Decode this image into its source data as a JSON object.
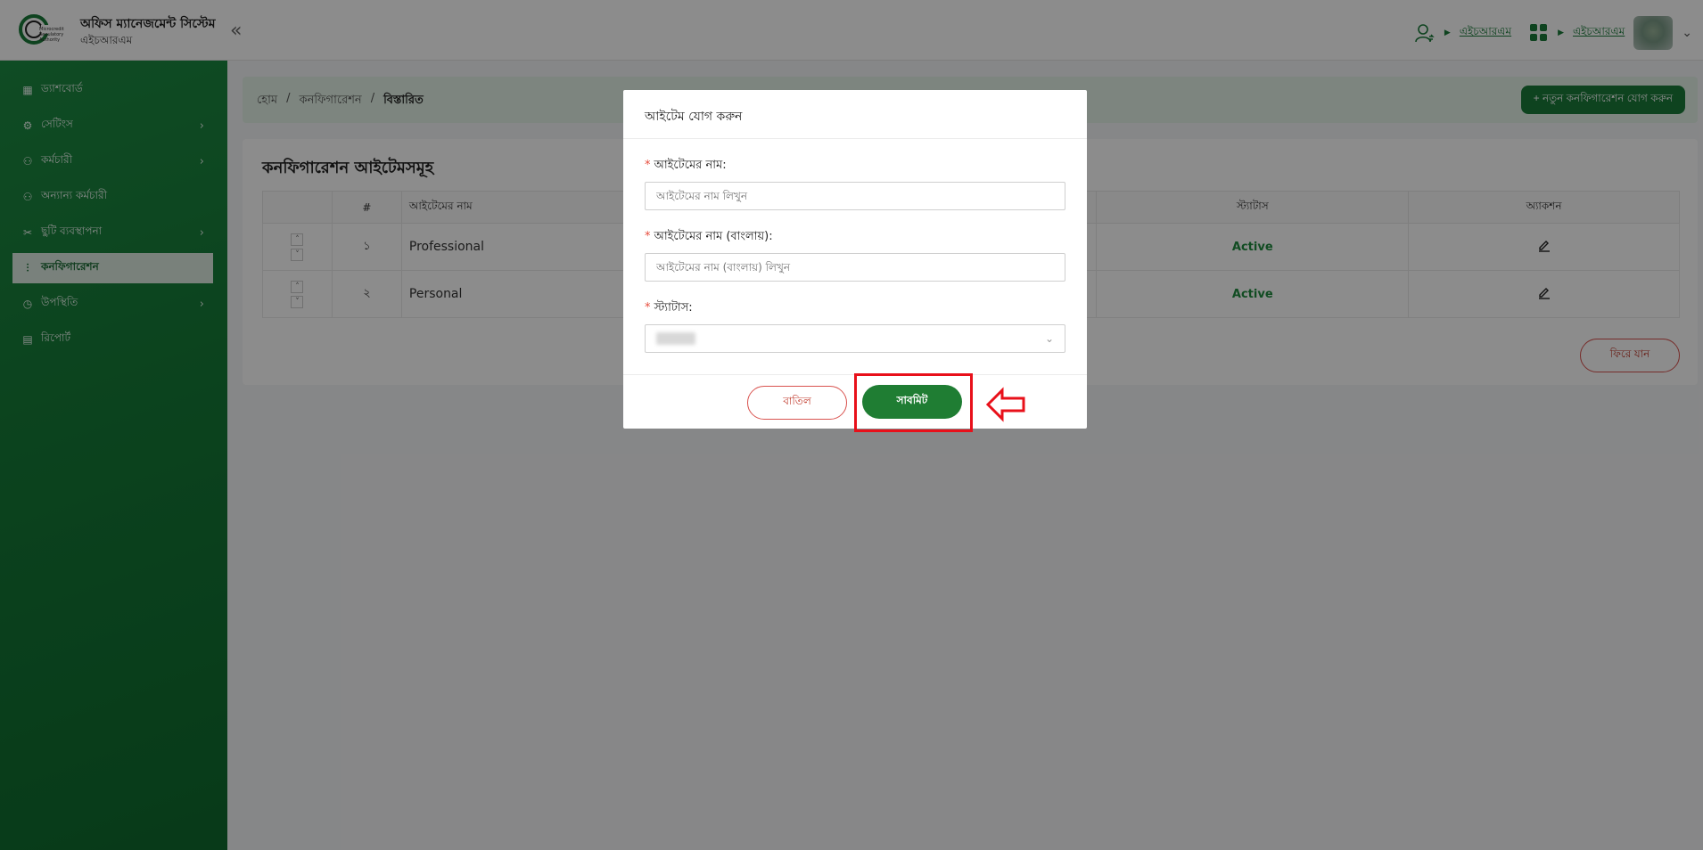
{
  "app": {
    "title": "অফিস ম্যানেজমেন্ট সিস্টেম",
    "subtitle": "এইচআরএম",
    "collapse_glyph": "«"
  },
  "header": {
    "role_link": "এইচআরএম",
    "module_link": "এইচআরএম",
    "arrow_glyph": "▶",
    "dropdown_glyph": "⌄"
  },
  "sidebar": {
    "items": [
      {
        "label": "ড্যাশবোর্ড",
        "icon": "dashboard-icon",
        "glyph": "▦",
        "chevron": ""
      },
      {
        "label": "সেটিংস",
        "icon": "gear-icon",
        "glyph": "⚙",
        "chevron": "›"
      },
      {
        "label": "কর্মচারী",
        "icon": "users-icon",
        "glyph": "⚇",
        "chevron": "›"
      },
      {
        "label": "অন্যান্য কর্মচারী",
        "icon": "users-icon",
        "glyph": "⚇",
        "chevron": ""
      },
      {
        "label": "ছুটি ব্যবস্থাপনা",
        "icon": "leaf-icon",
        "glyph": "✂",
        "chevron": "›"
      },
      {
        "label": "কনফিগারেশন",
        "icon": "sliders-icon",
        "glyph": "⫶",
        "chevron": ""
      },
      {
        "label": "উপস্থিতি",
        "icon": "clock-icon",
        "glyph": "◷",
        "chevron": "›"
      },
      {
        "label": "রিপোর্ট",
        "icon": "document-icon",
        "glyph": "▤",
        "chevron": ""
      }
    ],
    "active_index": 5
  },
  "breadcrumb": {
    "items": [
      "হোম",
      "কনফিগারেশন",
      "বিস্তারিত"
    ],
    "separator": "/"
  },
  "add_config_button": "+ নতুন কনফিগারেশন যোগ করুন",
  "card": {
    "title": "কনফিগারেশন আইটেমসমূহ",
    "columns": [
      "",
      "#",
      "আইটেমের নাম",
      "স্ট্যাটাস",
      "অ্যাকশন"
    ],
    "rows": [
      {
        "index": "১",
        "name": "Professional",
        "status": "Active",
        "sort_glyph_up": "˄",
        "sort_glyph_down": "˅"
      },
      {
        "index": "২",
        "name": "Personal",
        "status": "Active",
        "sort_glyph_up": "˄",
        "sort_glyph_down": "˅"
      }
    ],
    "back_button": "ফিরে যান"
  },
  "modal": {
    "title": "আইটেম যোগ করুন",
    "required_mark": "*",
    "fields": {
      "name_label": "আইটেমের নাম:",
      "name_placeholder": "আইটেমের নাম লিখুন",
      "name_bn_label": "আইটেমের নাম (বাংলায়):",
      "name_bn_placeholder": "আইটেমের নাম (বাংলায়) লিখুন",
      "status_label": "স্ট্যাটাস:",
      "status_chevron": "⌄"
    },
    "cancel_button": "বাতিল",
    "submit_button": "সাবমিট"
  },
  "colors": {
    "primary": "#1a7a3a",
    "sidebar": "#157a37",
    "danger": "#d9534f",
    "annotation": "#e8101a",
    "status_active": "#1f8a3f"
  }
}
